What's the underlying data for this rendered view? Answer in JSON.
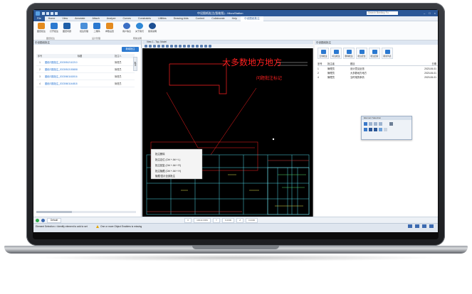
{
  "window": {
    "title": "中设图纸批注(智能版) - MicroStation",
    "search_placeholder": "Search Bentley Fo"
  },
  "ribbon_tabs": [
    "File",
    "Home",
    "View",
    "Annotate",
    "Attach",
    "Analyze",
    "Curves",
    "Constraints",
    "Utilities",
    "Drawing Aids",
    "Content",
    "Collaborate",
    "Help",
    "中设图纸批注"
  ],
  "ribbon": {
    "buttons": [
      {
        "label": "图纸批注"
      },
      {
        "label": "打开批注"
      },
      {
        "label": "图纸问题"
      },
      {
        "label": "批注管理"
      },
      {
        "label": "二维码"
      },
      {
        "label": "参数设置"
      },
      {
        "label": "用户信息"
      },
      {
        "label": "关于我们"
      },
      {
        "label": "使用说明"
      }
    ],
    "groups": [
      "图纸批注",
      "设计管理",
      "帮助说明"
    ]
  },
  "left_panel": {
    "header": "中设图纸批注",
    "button": "新增批注",
    "columns": {
      "no": "序号",
      "title": "标题",
      "user": "批注人"
    },
    "rows": [
      {
        "no": "1",
        "title": "图纸问题批注_20230512112210",
        "user": "管理员"
      },
      {
        "no": "2",
        "title": "图纸问题批注_20230513153658",
        "user": "管理员"
      },
      {
        "no": "3",
        "title": "图纸问题批注_20230601163016",
        "user": "管理员"
      },
      {
        "no": "4",
        "title": "图纸问题批注_20230601144818",
        "user": "管理员"
      }
    ],
    "vtab_1": "批注",
    "vtab_2": "问题",
    "vtab_3": "版本"
  },
  "view": {
    "title": "View 1 - Top, Model",
    "annotation_main": "大多数地方地方",
    "annotation_small": "问题批注标记",
    "context_menu": [
      "批注删除",
      "批注定位 (Ctrl + Alt + L)",
      "批注回复 (Ctrl + Alt + R)",
      "批注隐藏 (Ctrl + Alt + H)",
      "隐藏/显示全部批注"
    ]
  },
  "right_panel": {
    "header": "中设图纸批注",
    "tools": [
      {
        "label": "云线批注"
      },
      {
        "label": "标注批注"
      },
      {
        "label": "删除批注"
      },
      {
        "label": "批注定位"
      },
      {
        "label": "批注回复"
      },
      {
        "label": "刷新列表"
      }
    ],
    "columns": {
      "no": "序号",
      "user": "批注者",
      "title": "题目",
      "date": "日期"
    },
    "rows": [
      {
        "no": "1",
        "user": "管理员",
        "title": "设计意见反馈",
        "date": "2023-06-01"
      },
      {
        "no": "2",
        "user": "管理员",
        "title": "大多数地方地方",
        "date": "2023-06-01"
      },
      {
        "no": "4",
        "user": "管理员",
        "title": "当时他的事情",
        "date": "2023-06-01"
      }
    ]
  },
  "floating_toolbar": {
    "title": "Element Selection"
  },
  "navbar": {
    "model": "Default",
    "x_label": "X",
    "x_value": "10043.6969",
    "y_label": "Y",
    "y_value": "6.0000",
    "z_label": "Z",
    "z_value": "0.0000"
  },
  "status": {
    "message": "Element Selection > Identify element to add to set",
    "warning": "One or more Object Enablers is missing"
  },
  "colors": {
    "accent": "#2b5797",
    "link": "#1f6fd1",
    "markup": "#ff2020"
  }
}
